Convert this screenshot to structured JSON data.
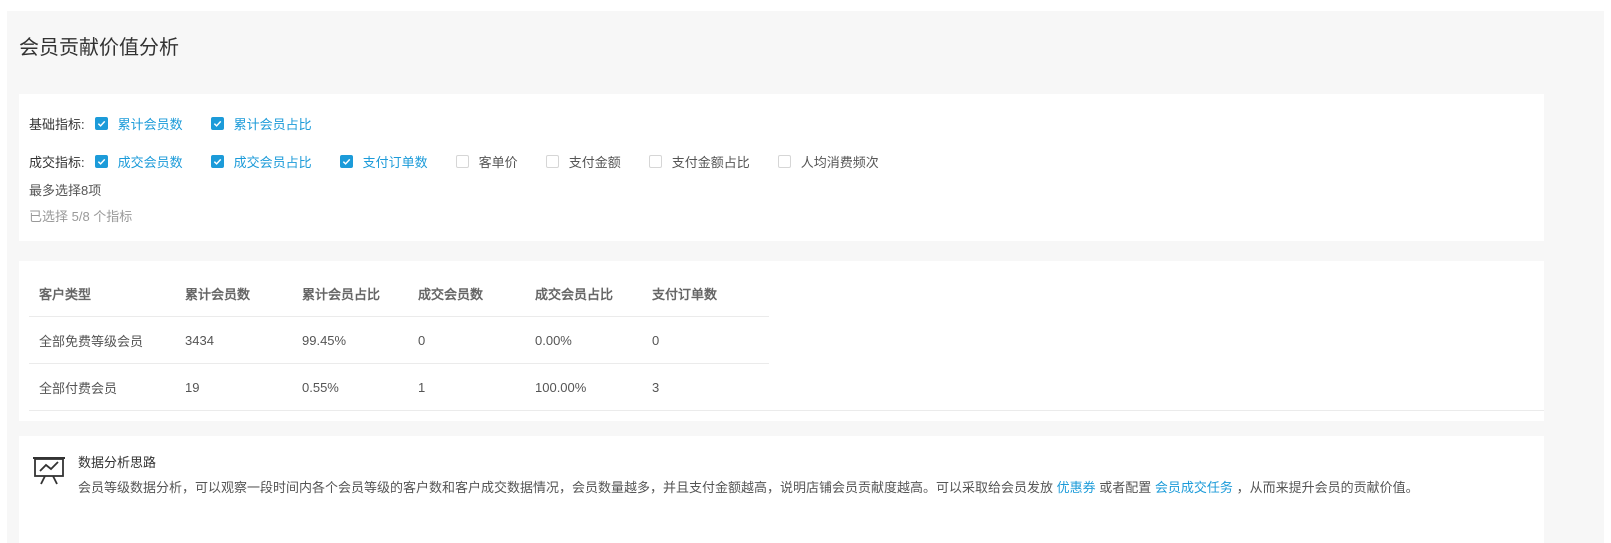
{
  "page": {
    "title": "会员贡献价值分析"
  },
  "filters": {
    "basic": {
      "label": "基础指标:",
      "options": [
        {
          "label": "累计会员数",
          "checked": true
        },
        {
          "label": "累计会员占比",
          "checked": true
        }
      ]
    },
    "deal": {
      "label": "成交指标:",
      "options": [
        {
          "label": "成交会员数",
          "checked": true
        },
        {
          "label": "成交会员占比",
          "checked": true
        },
        {
          "label": "支付订单数",
          "checked": true
        },
        {
          "label": "客单价",
          "checked": false
        },
        {
          "label": "支付金额",
          "checked": false
        },
        {
          "label": "支付金额占比",
          "checked": false
        },
        {
          "label": "人均消费频次",
          "checked": false
        }
      ]
    },
    "max_hint": "最多选择8项",
    "selected_hint": "已选择 5/8 个指标"
  },
  "table": {
    "headers": [
      "客户类型",
      "累计会员数",
      "累计会员占比",
      "成交会员数",
      "成交会员占比",
      "支付订单数"
    ],
    "rows": [
      [
        "全部免费等级会员",
        "3434",
        "99.45%",
        "0",
        "0.00%",
        "0"
      ],
      [
        "全部付费会员",
        "19",
        "0.55%",
        "1",
        "100.00%",
        "3"
      ]
    ]
  },
  "tips": {
    "title": "数据分析思路",
    "text_1": "会员等级数据分析，可以观察一段时间内各个会员等级的客户数和客户成交数据情况，会员数量越多，并且支付金额越高，说明店铺会员贡献度越高。可以采取给会员发放",
    "link_1": "优惠券",
    "text_2": "或者配置",
    "link_2": "会员成交任务",
    "text_3": "，从而来提升会员的贡献价值。"
  },
  "colors": {
    "accent": "#1c9bd9",
    "background": "#f7f7f7"
  },
  "icons": {
    "checkbox_checked": "check-icon",
    "tips": "presentation-chart-icon"
  }
}
